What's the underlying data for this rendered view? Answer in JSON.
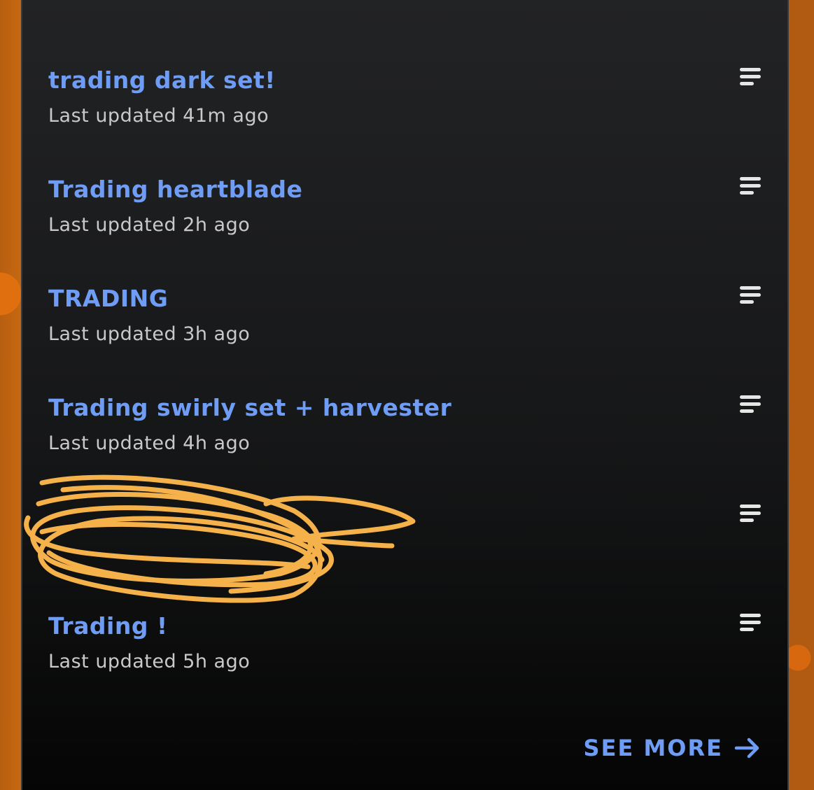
{
  "list": {
    "items": [
      {
        "title": "trading dark set!",
        "subtitle": "Last updated 41m ago"
      },
      {
        "title": "Trading heartblade",
        "subtitle": "Last updated 2h ago"
      },
      {
        "title": "TRADING",
        "subtitle": "Last updated 3h ago"
      },
      {
        "title": "Trading swirly set + harvester",
        "subtitle": "Last updated 4h ago"
      },
      {
        "title": "",
        "subtitle": ""
      },
      {
        "title": "Trading !",
        "subtitle": "Last updated 5h ago"
      }
    ]
  },
  "footer": {
    "see_more_label": "SEE MORE"
  },
  "colors": {
    "accent": "#6f9df5",
    "scribble": "#f5b24a"
  }
}
